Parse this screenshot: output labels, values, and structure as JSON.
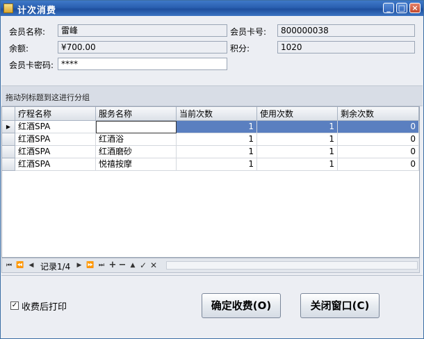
{
  "window": {
    "title": "计次消费"
  },
  "form": {
    "member_name_label": "会员名称:",
    "member_name_value": "雷峰",
    "card_no_label": "会员卡号:",
    "card_no_value": "800000038",
    "balance_label": "余额:",
    "balance_value": "¥700.00",
    "points_label": "积分:",
    "points_value": "1020",
    "password_label": "会员卡密码:",
    "password_value": "****"
  },
  "group_hint": "拖动列标题到这进行分组",
  "grid": {
    "columns": [
      "疗程名称",
      "服务名称",
      "当前次数",
      "使用次数",
      "剩余次数"
    ],
    "rows": [
      [
        "红酒SPA",
        "",
        "1",
        "1",
        "0"
      ],
      [
        "红酒SPA",
        "红酒浴",
        "1",
        "1",
        "0"
      ],
      [
        "红酒SPA",
        "红酒磨砂",
        "1",
        "1",
        "0"
      ],
      [
        "红酒SPA",
        "悦禧按摩",
        "1",
        "1",
        "0"
      ]
    ]
  },
  "navigator": {
    "record_text": "记录1/4"
  },
  "footer": {
    "print_label": "收费后打印",
    "print_checked": true,
    "confirm_label": "确定收费(O)",
    "close_label": "关闭窗口(C)"
  }
}
